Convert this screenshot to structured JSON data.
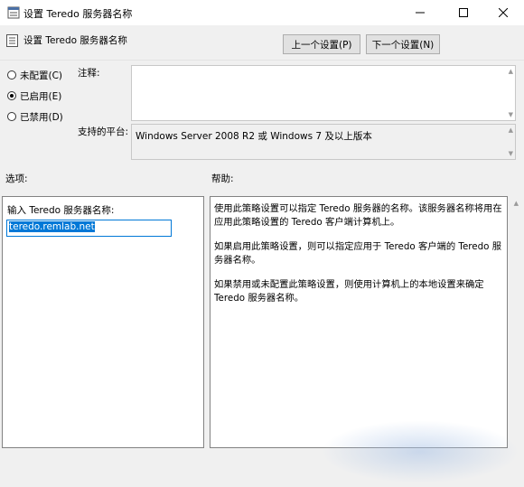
{
  "window": {
    "title": "设置 Teredo 服务器名称",
    "app_icon": "policy-setting-icon",
    "controls": {
      "minimize": "minimize-icon",
      "maximize": "maximize-icon",
      "close": "close-icon"
    }
  },
  "header": {
    "title": "设置 Teredo 服务器名称",
    "prev_label": "上一个设置(P)",
    "next_label": "下一个设置(N)"
  },
  "state": {
    "options": [
      {
        "label": "未配置(C)",
        "selected": false
      },
      {
        "label": "已启用(E)",
        "selected": true
      },
      {
        "label": "已禁用(D)",
        "selected": false
      }
    ]
  },
  "comment": {
    "label": "注释:",
    "value": ""
  },
  "platform": {
    "label": "支持的平台:",
    "value": "Windows Server 2008 R2 或 Windows 7 及以上版本"
  },
  "options_section": {
    "label": "选项:",
    "field_label": "输入 Teredo 服务器名称:",
    "field_value": "teredo.remlab.net"
  },
  "help_section": {
    "label": "帮助:",
    "lines": [
      "使用此策略设置可以指定 Teredo 服务器的名称。该服务器名称将用在",
      "应用此策略设置的 Teredo 客户端计算机上。",
      "如果启用此策略设置，则可以指定应用于 Teredo 客户端的 Teredo 服",
      "务器名称。",
      "如果禁用或未配置此策略设置，则使用计算机上的本地设置来确定",
      "Teredo 服务器名称。"
    ]
  },
  "colors": {
    "accent": "#0078d7",
    "background": "#f0f0f0",
    "panel_border": "#828282"
  }
}
